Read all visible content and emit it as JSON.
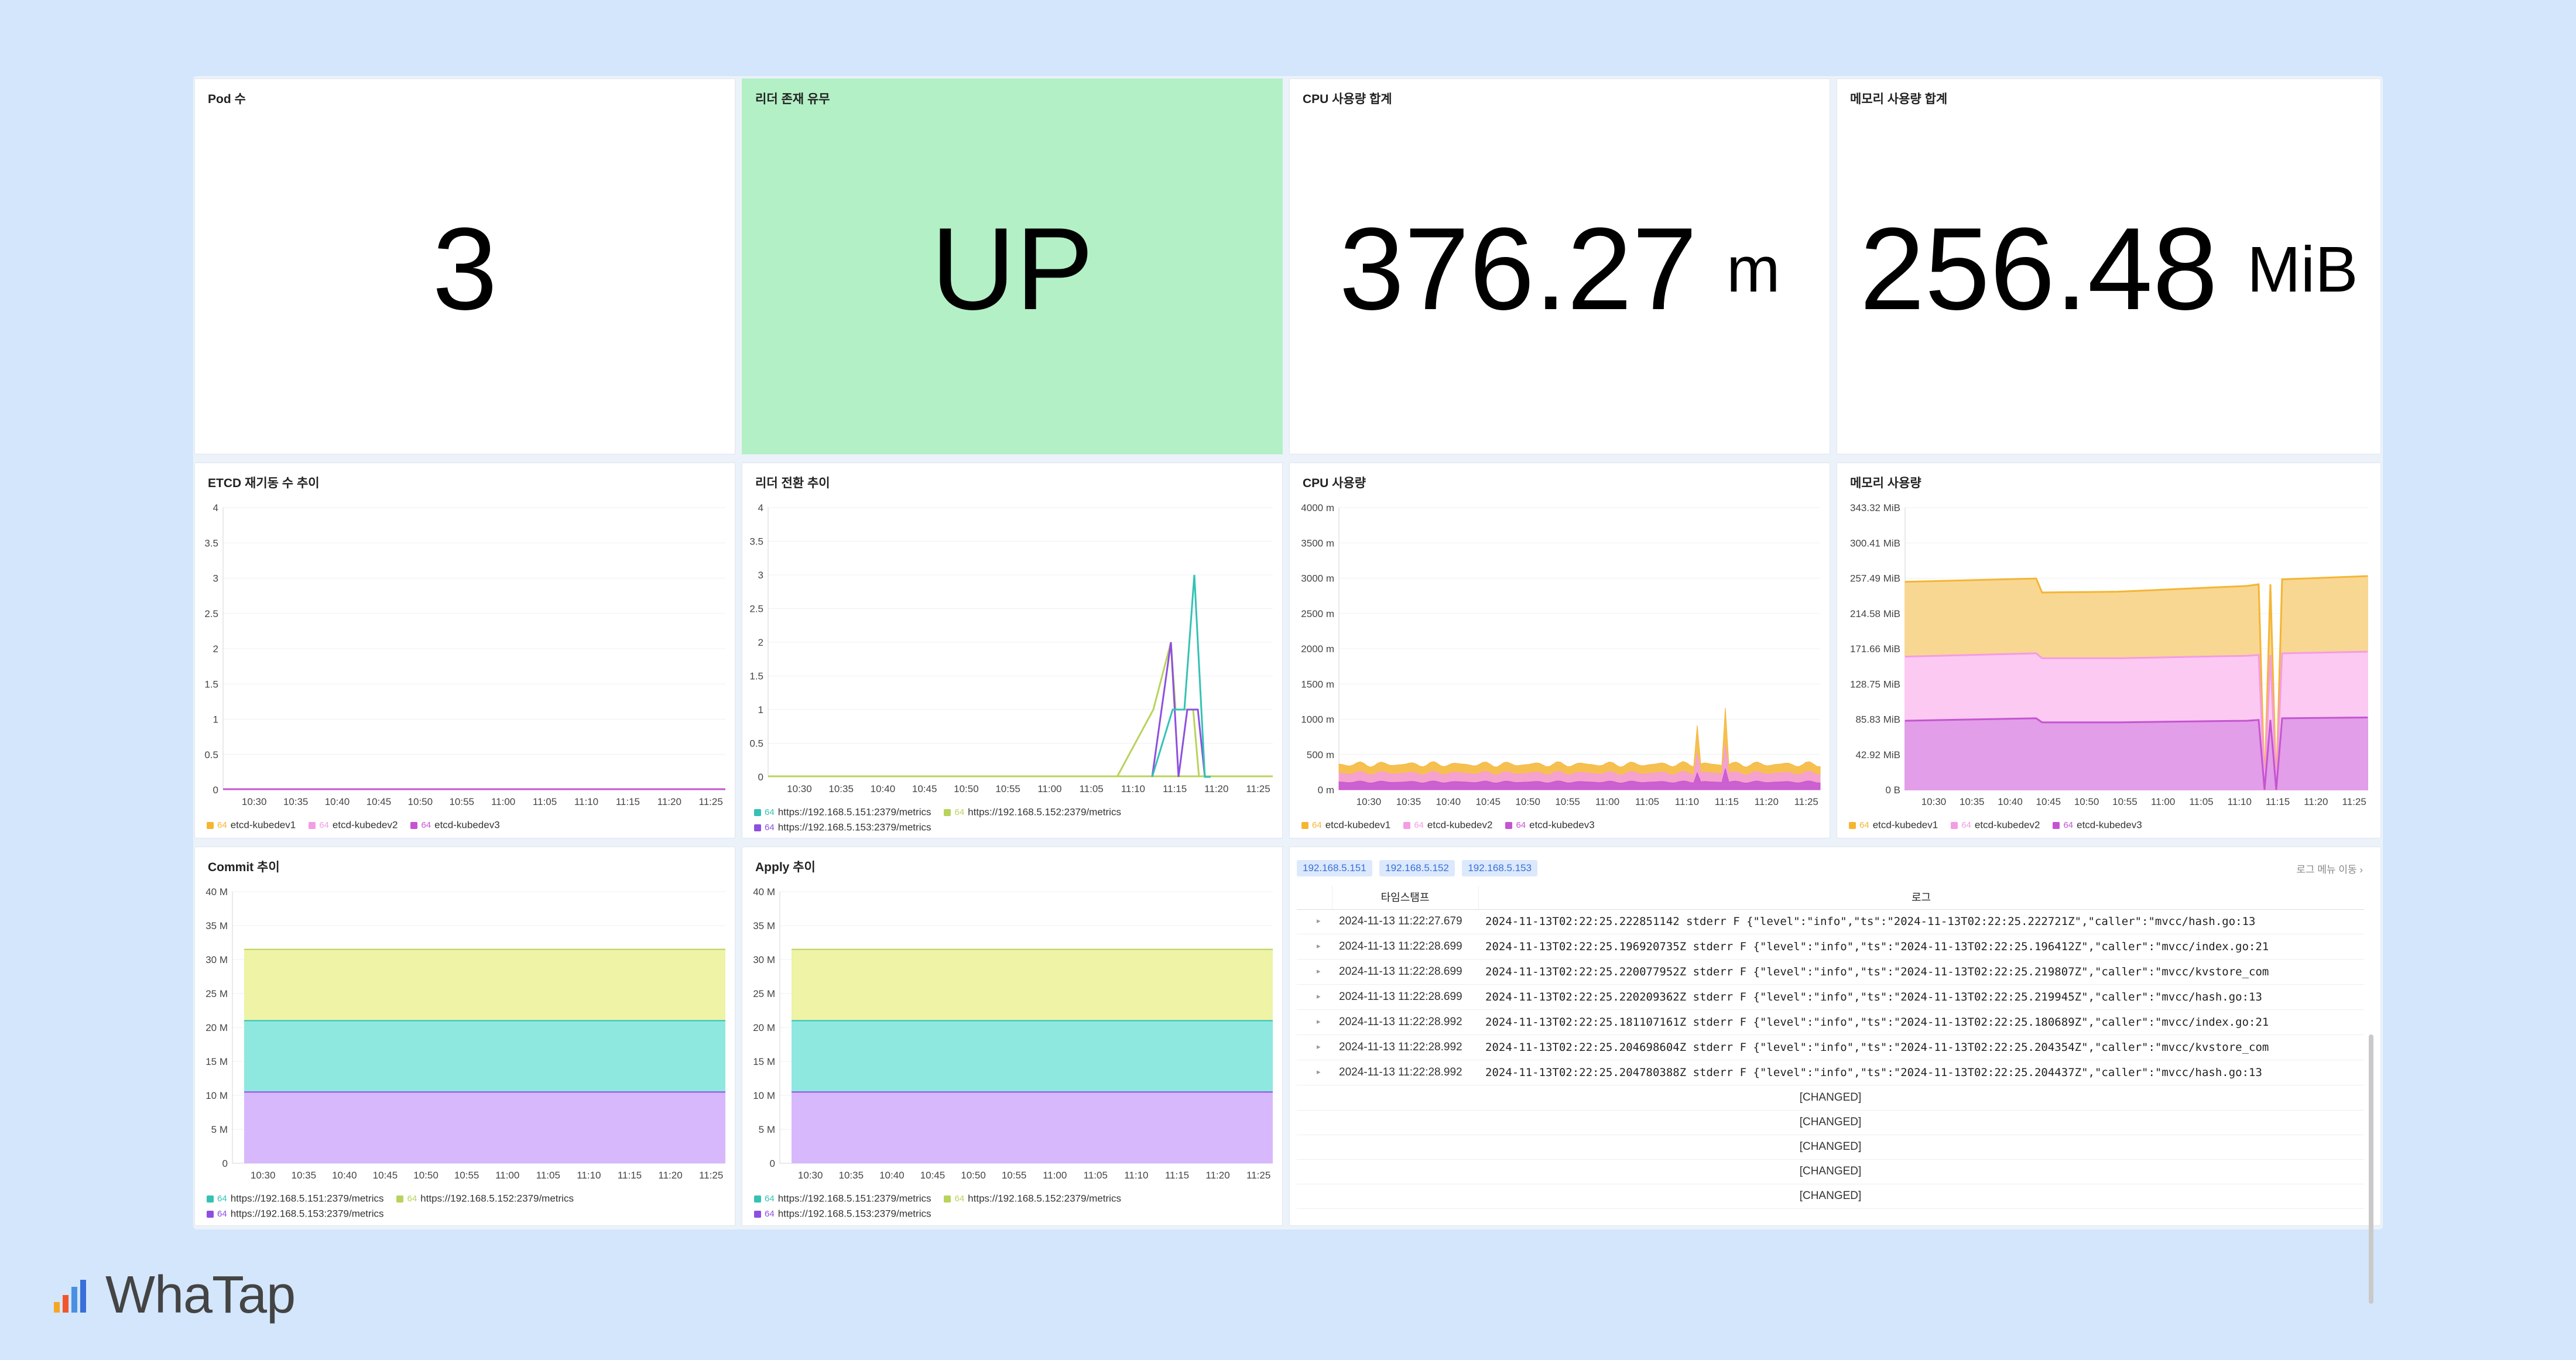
{
  "colors": {
    "yellow": "#f5b533",
    "pink": "#f49ce4",
    "purple": "#c455d1",
    "teal": "#34c2b4",
    "lime": "#b8d35b",
    "violet": "#8e4fe0",
    "green_bg": "#b3f0c6"
  },
  "stats": {
    "pods": {
      "title": "Pod 수",
      "value": "3"
    },
    "leader": {
      "title": "리더 존재 유무",
      "value": "UP"
    },
    "cpu": {
      "title": "CPU 사용량 합계",
      "value": "376.27",
      "unit": "m"
    },
    "mem": {
      "title": "메모리 사용량 합계",
      "value": "256.48",
      "unit": "MiB"
    }
  },
  "time_ticks": [
    "10:30",
    "10:35",
    "10:40",
    "10:45",
    "10:50",
    "10:55",
    "11:00",
    "11:05",
    "11:10",
    "11:15",
    "11:20",
    "11:25"
  ],
  "charts": {
    "restart": {
      "title": "ETCD 재기동 수 추이",
      "y_ticks": [
        "4",
        "3.5",
        "3",
        "2.5",
        "2",
        "1.5",
        "1",
        "0.5",
        "0"
      ],
      "legend": [
        {
          "count": "64",
          "label": "etcd-kubedev1",
          "color": "#f5b533"
        },
        {
          "count": "64",
          "label": "etcd-kubedev2",
          "color": "#f49ce4"
        },
        {
          "count": "64",
          "label": "etcd-kubedev3",
          "color": "#c455d1"
        }
      ]
    },
    "leader_change": {
      "title": "리더 전환 추이",
      "y_ticks": [
        "4",
        "3.5",
        "3",
        "2.5",
        "2",
        "1.5",
        "1",
        "0.5",
        "0"
      ],
      "legend_row1": [
        {
          "count": "64",
          "label": "https://192.168.5.151:2379/metrics",
          "color": "#34c2b4"
        },
        {
          "count": "64",
          "label": "https://192.168.5.152:2379/metrics",
          "color": "#b8d35b"
        }
      ],
      "legend_row2": [
        {
          "count": "64",
          "label": "https://192.168.5.153:2379/metrics",
          "color": "#8e4fe0"
        }
      ]
    },
    "cpu": {
      "title": "CPU 사용량",
      "y_ticks": [
        "4000 m",
        "3500 m",
        "3000 m",
        "2500 m",
        "2000 m",
        "1500 m",
        "1000 m",
        "500 m",
        "0 m"
      ],
      "legend": [
        {
          "count": "64",
          "label": "etcd-kubedev1",
          "color": "#f5b533"
        },
        {
          "count": "64",
          "label": "etcd-kubedev2",
          "color": "#f49ce4"
        },
        {
          "count": "64",
          "label": "etcd-kubedev3",
          "color": "#c455d1"
        }
      ]
    },
    "mem": {
      "title": "메모리 사용량",
      "y_ticks": [
        "343.32 MiB",
        "300.41 MiB",
        "257.49 MiB",
        "214.58 MiB",
        "171.66 MiB",
        "128.75 MiB",
        "85.83 MiB",
        "42.92 MiB",
        "0 B"
      ],
      "legend": [
        {
          "count": "64",
          "label": "etcd-kubedev1",
          "color": "#f5b533"
        },
        {
          "count": "64",
          "label": "etcd-kubedev2",
          "color": "#f49ce4"
        },
        {
          "count": "64",
          "label": "etcd-kubedev3",
          "color": "#c455d1"
        }
      ]
    },
    "commit": {
      "title": "Commit 추이",
      "y_ticks": [
        "40 M",
        "35 M",
        "30 M",
        "25 M",
        "20 M",
        "15 M",
        "10 M",
        "5 M",
        "0"
      ],
      "legend_row1": [
        {
          "count": "64",
          "label": "https://192.168.5.151:2379/metrics",
          "color": "#34c2b4"
        },
        {
          "count": "64",
          "label": "https://192.168.5.152:2379/metrics",
          "color": "#b8d35b"
        }
      ],
      "legend_row2": [
        {
          "count": "64",
          "label": "https://192.168.5.153:2379/metrics",
          "color": "#8e4fe0"
        }
      ]
    },
    "apply": {
      "title": "Apply 추이",
      "y_ticks": [
        "40 M",
        "35 M",
        "30 M",
        "25 M",
        "20 M",
        "15 M",
        "10 M",
        "5 M",
        "0"
      ],
      "legend_row1": [
        {
          "count": "64",
          "label": "https://192.168.5.151:2379/metrics",
          "color": "#34c2b4"
        },
        {
          "count": "64",
          "label": "https://192.168.5.152:2379/metrics",
          "color": "#b8d35b"
        }
      ],
      "legend_row2": [
        {
          "count": "64",
          "label": "https://192.168.5.153:2379/metrics",
          "color": "#8e4fe0"
        }
      ]
    }
  },
  "chart_data": [
    {
      "type": "line",
      "title": "ETCD 재기동 수 추이",
      "x": [
        "10:30",
        "10:35",
        "10:40",
        "10:45",
        "10:50",
        "10:55",
        "11:00",
        "11:05",
        "11:10",
        "11:15",
        "11:20",
        "11:25"
      ],
      "ylim": [
        0,
        4
      ],
      "series": [
        {
          "name": "etcd-kubedev1",
          "values": [
            0,
            0,
            0,
            0,
            0,
            0,
            0,
            0,
            0,
            0,
            0,
            0
          ]
        },
        {
          "name": "etcd-kubedev2",
          "values": [
            0,
            0,
            0,
            0,
            0,
            0,
            0,
            0,
            0,
            0,
            0,
            0
          ]
        },
        {
          "name": "etcd-kubedev3",
          "values": [
            0,
            0,
            0,
            0,
            0,
            0,
            0,
            0,
            0,
            0,
            0,
            0
          ]
        }
      ]
    },
    {
      "type": "line",
      "title": "리더 전환 추이",
      "x": [
        "11:10",
        "11:12",
        "11:13",
        "11:14",
        "11:15",
        "11:16",
        "11:17",
        "11:18"
      ],
      "ylim": [
        0,
        4
      ],
      "series": [
        {
          "name": "https://192.168.5.151:2379/metrics",
          "values": [
            0,
            0,
            1,
            1,
            3,
            0,
            0,
            0
          ]
        },
        {
          "name": "https://192.168.5.152:2379/metrics",
          "values": [
            0,
            1,
            2,
            1,
            1,
            0,
            0,
            0
          ]
        },
        {
          "name": "https://192.168.5.153:2379/metrics",
          "values": [
            0,
            0,
            2,
            0,
            1,
            0,
            0,
            0
          ]
        }
      ]
    },
    {
      "type": "area",
      "title": "CPU 사용량",
      "ylim": [
        0,
        4000
      ],
      "series": [
        {
          "name": "etcd-kubedev1",
          "values": [
            350,
            360,
            340,
            355,
            350,
            345,
            360,
            350,
            340,
            1200,
            350,
            340
          ]
        },
        {
          "name": "etcd-kubedev2",
          "values": [
            230,
            240,
            225,
            235,
            230,
            228,
            235,
            232,
            230,
            600,
            230,
            228
          ]
        },
        {
          "name": "etcd-kubedev3",
          "values": [
            110,
            115,
            108,
            112,
            110,
            108,
            112,
            110,
            108,
            300,
            110,
            108
          ]
        }
      ]
    },
    {
      "type": "area",
      "title": "메모리 사용량",
      "ylim": [
        0,
        343.32
      ],
      "series": [
        {
          "name": "etcd-kubedev1",
          "values": [
            253,
            256,
            257,
            240,
            240,
            245,
            248,
            250,
            252,
            255,
            256,
            258
          ]
        },
        {
          "name": "etcd-kubedev2",
          "values": [
            162,
            165,
            166,
            164,
            160,
            160,
            161,
            162,
            163,
            165,
            166,
            168
          ]
        },
        {
          "name": "etcd-kubedev3",
          "values": [
            84,
            86,
            87,
            82,
            82,
            83,
            83,
            84,
            85,
            86,
            87,
            88
          ]
        }
      ]
    },
    {
      "type": "area",
      "title": "Commit 추이",
      "ylim": [
        0,
        40
      ],
      "series": [
        {
          "name": "https://192.168.5.153:2379/metrics",
          "values": [
            10.5,
            10.5,
            10.5,
            10.5,
            10.5,
            10.5,
            10.5,
            10.5,
            10.5,
            10.5,
            10.5,
            10.5
          ]
        },
        {
          "name": "https://192.168.5.151:2379/metrics",
          "values": [
            21,
            21,
            21,
            21,
            21,
            21,
            21,
            21,
            21,
            21,
            21,
            21
          ]
        },
        {
          "name": "https://192.168.5.152:2379/metrics",
          "values": [
            31.5,
            31.5,
            31.5,
            31.5,
            31.5,
            31.5,
            31.5,
            31.5,
            31.5,
            31.5,
            31.5,
            31.5
          ]
        }
      ]
    },
    {
      "type": "area",
      "title": "Apply 추이",
      "ylim": [
        0,
        40
      ],
      "series": [
        {
          "name": "https://192.168.5.153:2379/metrics",
          "values": [
            10.5,
            10.5,
            10.5,
            10.5,
            10.5,
            10.5,
            10.5,
            10.5,
            10.5,
            10.5,
            10.5,
            10.5
          ]
        },
        {
          "name": "https://192.168.5.151:2379/metrics",
          "values": [
            21,
            21,
            21,
            21,
            21,
            21,
            21,
            21,
            21,
            21,
            21,
            21
          ]
        },
        {
          "name": "https://192.168.5.152:2379/metrics",
          "values": [
            31.5,
            31.5,
            31.5,
            31.5,
            31.5,
            31.5,
            31.5,
            31.5,
            31.5,
            31.5,
            31.5,
            31.5
          ]
        }
      ]
    }
  ],
  "logs": {
    "ip_tabs": [
      "192.168.5.151",
      "192.168.5.152",
      "192.168.5.153"
    ],
    "menu_label": "로그 메뉴 이동 ›",
    "col_ts": "타임스탬프",
    "col_log": "로그",
    "rows": [
      {
        "ts": "2024-11-13 11:22:27.679",
        "msg": "2024-11-13T02:22:25.222851142 stderr F {\"level\":\"info\",\"ts\":\"2024-11-13T02:22:25.222721Z\",\"caller\":\"mvcc/hash.go:13"
      },
      {
        "ts": "2024-11-13 11:22:28.699",
        "msg": "2024-11-13T02:22:25.196920735Z stderr F {\"level\":\"info\",\"ts\":\"2024-11-13T02:22:25.196412Z\",\"caller\":\"mvcc/index.go:21"
      },
      {
        "ts": "2024-11-13 11:22:28.699",
        "msg": "2024-11-13T02:22:25.220077952Z stderr F {\"level\":\"info\",\"ts\":\"2024-11-13T02:22:25.219807Z\",\"caller\":\"mvcc/kvstore_com"
      },
      {
        "ts": "2024-11-13 11:22:28.699",
        "msg": "2024-11-13T02:22:25.220209362Z stderr F {\"level\":\"info\",\"ts\":\"2024-11-13T02:22:25.219945Z\",\"caller\":\"mvcc/hash.go:13"
      },
      {
        "ts": "2024-11-13 11:22:28.992",
        "msg": "2024-11-13T02:22:25.181107161Z stderr F {\"level\":\"info\",\"ts\":\"2024-11-13T02:22:25.180689Z\",\"caller\":\"mvcc/index.go:21"
      },
      {
        "ts": "2024-11-13 11:22:28.992",
        "msg": "2024-11-13T02:22:25.204698604Z stderr F {\"level\":\"info\",\"ts\":\"2024-11-13T02:22:25.204354Z\",\"caller\":\"mvcc/kvstore_com"
      },
      {
        "ts": "2024-11-13 11:22:28.992",
        "msg": "2024-11-13T02:22:25.204780388Z stderr F {\"level\":\"info\",\"ts\":\"2024-11-13T02:22:25.204437Z\",\"caller\":\"mvcc/hash.go:13"
      }
    ],
    "changed": [
      "[CHANGED]",
      "[CHANGED]",
      "[CHANGED]",
      "[CHANGED]",
      "[CHANGED]"
    ]
  },
  "brand": {
    "name": "WhaTap"
  }
}
